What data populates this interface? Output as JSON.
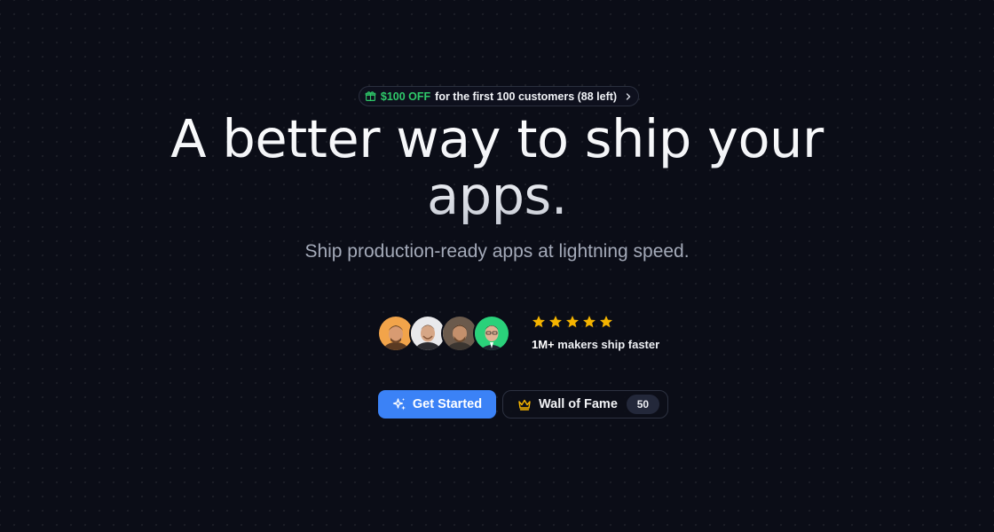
{
  "promo": {
    "discount": "$100 OFF",
    "text": "for the first 100 customers (88 left)"
  },
  "hero": {
    "headline_line1": "A better way to ship your",
    "headline_line2": "apps.",
    "subtitle": "Ship production-ready apps at lightning speed."
  },
  "social_proof": {
    "rating_stars": 5,
    "count": "1M+",
    "text": "makers ship faster"
  },
  "cta": {
    "primary_label": "Get Started",
    "secondary_label": "Wall of Fame",
    "secondary_count": "50"
  },
  "colors": {
    "background": "#0b0d17",
    "accent": "#3b82f6",
    "promo_green": "#2fc96a",
    "star": "#f5b400"
  },
  "icons": {
    "promo": "gift-icon",
    "promo_arrow": "chevron-right-icon",
    "primary": "sparkles-icon",
    "secondary": "crown-icon",
    "rating": "star-icon"
  }
}
